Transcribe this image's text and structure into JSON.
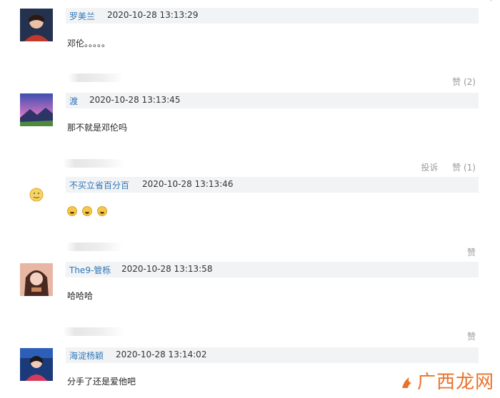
{
  "top_fragment": "⁄",
  "comments": [
    {
      "user": "罗美兰",
      "time": "2020-10-28 13:13:29",
      "text": "邓伦。。。。。",
      "actions": [],
      "avatar": "person-avatar-red"
    },
    {
      "user": "渡",
      "time": "2020-10-28 13:13:45",
      "text": "那不就是邓伦吗",
      "actions": [
        "赞 (2)"
      ],
      "avatar": "landscape-avatar"
    },
    {
      "user": "不买立省百分百",
      "time": "2020-10-28 13:13:46",
      "text": "",
      "emojis": 3,
      "actions": [
        "投诉",
        "赞 (1)"
      ],
      "avatar": "smiley-avatar"
    },
    {
      "user": "The9-管栎",
      "time": "2020-10-28 13:13:58",
      "text": "哈哈哈",
      "actions": [
        "赞"
      ],
      "avatar": "girl-avatar"
    },
    {
      "user": "海淀杨颖",
      "time": "2020-10-28 13:14:02",
      "text": "分手了还是爱他吧",
      "actions": [
        "赞"
      ],
      "avatar": "anchor-avatar"
    }
  ],
  "watermark": "广西龙网",
  "colors": {
    "user_link": "#2f76b6",
    "bar_bg": "#f1f3f5",
    "watermark": "#e86b1f"
  }
}
